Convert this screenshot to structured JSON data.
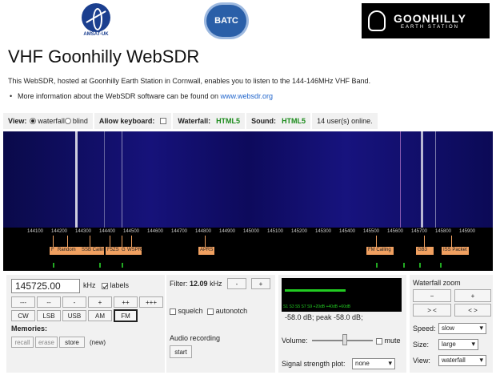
{
  "logos": {
    "amsat": "AMSAT-UK",
    "batc": "BATC",
    "goonhilly_name": "GOONHILLY",
    "goonhilly_sub": "EARTH STATION"
  },
  "title": "VHF Goonhilly WebSDR",
  "intro": "This WebSDR, hosted at Goonhilly Earth Station in Cornwall, enables you to listen to the 144-146MHz VHF Band.",
  "more_text": "More information about the WebSDR software can be found on ",
  "more_link": "www.websdr.org",
  "options": {
    "view_label": "View:",
    "view_waterfall": "waterfall",
    "view_blind": "blind",
    "keyboard_label": "Allow keyboard:",
    "waterfall_label": "Waterfall:",
    "waterfall_value": "HTML5",
    "sound_label": "Sound:",
    "sound_value": "HTML5",
    "users": "14 user(s) online."
  },
  "scale": {
    "ticks": [
      "144100",
      "144200",
      "144300",
      "144400",
      "144500",
      "144600",
      "144700",
      "144800",
      "144900",
      "145000",
      "145100",
      "145200",
      "145300",
      "145400",
      "145500",
      "145600",
      "145700",
      "145800",
      "145900"
    ]
  },
  "stations": [
    "F",
    "Random",
    "SSB Calling",
    "F5ZS",
    "G",
    "WSPR",
    "APRS",
    "FM Calling",
    "GB3",
    "ISS Packet"
  ],
  "tuning": {
    "frequency": "145725.00",
    "unit": "kHz",
    "labels": "labels",
    "step_buttons": [
      "---",
      "--",
      "-",
      "+",
      "++",
      "+++"
    ],
    "modes": [
      "CW",
      "LSB",
      "USB",
      "AM",
      "FM"
    ],
    "memories_label": "Memories:",
    "recall": "recall",
    "erase": "erase",
    "store": "store",
    "new_label": "(new)"
  },
  "filter": {
    "label": "Filter:",
    "value": "12.09",
    "unit": "kHz",
    "minus": "-",
    "plus": "+",
    "squelch": "squelch",
    "autonotch": "autonotch",
    "audio_recording": "Audio recording",
    "start": "start"
  },
  "signal": {
    "smeter_scale": "S1 S3 S5 S7 S9 +20dB +40dB +60dB",
    "readout": "-58.0 dB; peak  -58.0 dB;",
    "volume_label": "Volume:",
    "mute": "mute",
    "ssp_label": "Signal strength plot:",
    "ssp_value": "none"
  },
  "zoom": {
    "label": "Waterfall zoom",
    "minus": "−",
    "plus": "+",
    "narrow": "> <",
    "wide": "< >",
    "speed_label": "Speed:",
    "speed_value": "slow",
    "size_label": "Size:",
    "size_value": "large",
    "view_label": "View:",
    "view_value": "waterfall"
  }
}
